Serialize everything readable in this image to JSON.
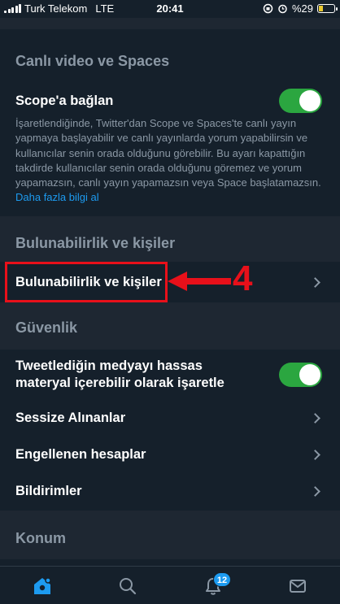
{
  "status_bar": {
    "carrier": "Turk Telekom",
    "network": "LTE",
    "time": "20:41",
    "battery": "%29"
  },
  "sections": {
    "live_video": {
      "title": "Canlı video ve Spaces",
      "scope_label": "Scope'a bağlan",
      "scope_toggle_on": true,
      "description": "İşaretlendiğinde, Twitter'dan Scope ve Spaces'te canlı yayın yapmaya başlayabilir ve canlı yayınlarda yorum yapabilirsin ve kullanıcılar senin orada olduğunu görebilir. Bu ayarı kapattığın takdirde kullanıcılar senin orada olduğunu göremez ve yorum yapamazsın, canlı yayın yapamazsın veya Space başlatamazsın.",
      "learn_more": "Daha fazla bilgi al"
    },
    "discoverability": {
      "title": "Bulunabilirlik ve kişiler",
      "item_label": "Bulunabilirlik ve kişiler"
    },
    "security": {
      "title": "Güvenlik",
      "sensitive_label": "Tweetlediğin medyayı hassas materyal içerebilir olarak işaretle",
      "sensitive_toggle_on": true,
      "muted_label": "Sessize Alınanlar",
      "blocked_label": "Engellenen hesaplar",
      "notifications_label": "Bildirimler"
    },
    "location": {
      "title": "Konum"
    }
  },
  "annotation": {
    "number": "4",
    "color": "#e8101a"
  },
  "tab_bar": {
    "tabs": [
      "home-icon",
      "search-icon",
      "notifications-icon",
      "messages-icon"
    ],
    "notification_count": "12"
  },
  "colors": {
    "background": "#15202b",
    "accent": "#1d9bf0",
    "toggle_on": "#2ba640",
    "secondary_text": "#8b98a5"
  }
}
